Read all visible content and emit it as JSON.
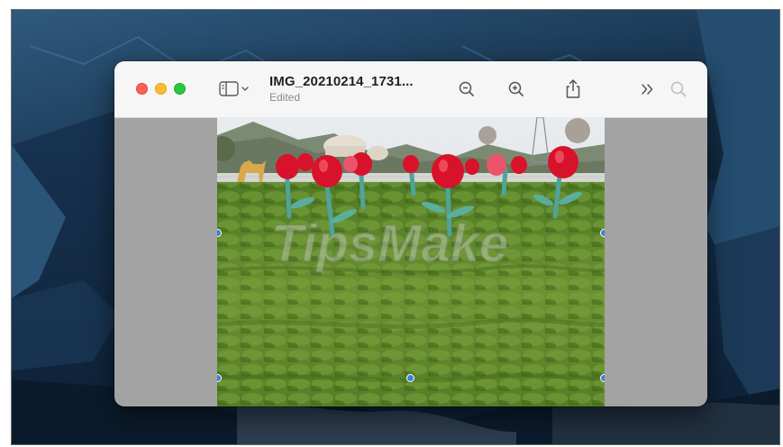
{
  "window": {
    "title": "IMG_20210214_1731...",
    "subtitle": "Edited"
  },
  "toolbar": {
    "icons": [
      "sidebar-toggle-icon",
      "chevron-down-icon",
      "zoom-out-icon",
      "zoom-in-icon",
      "share-icon",
      "more-chevrons-icon",
      "search-icon"
    ]
  },
  "image": {
    "watermark": "TipsMake",
    "description_colors": {
      "grass": "#5f8a2a",
      "flower": "#d8122a",
      "sky": "#dce4ea"
    }
  },
  "colors": {
    "close": "#fe5f57",
    "minimize": "#febc2e",
    "zoom": "#28c840",
    "selection_handle": "#3d82d6",
    "canvas_bg": "#a3a3a3"
  }
}
